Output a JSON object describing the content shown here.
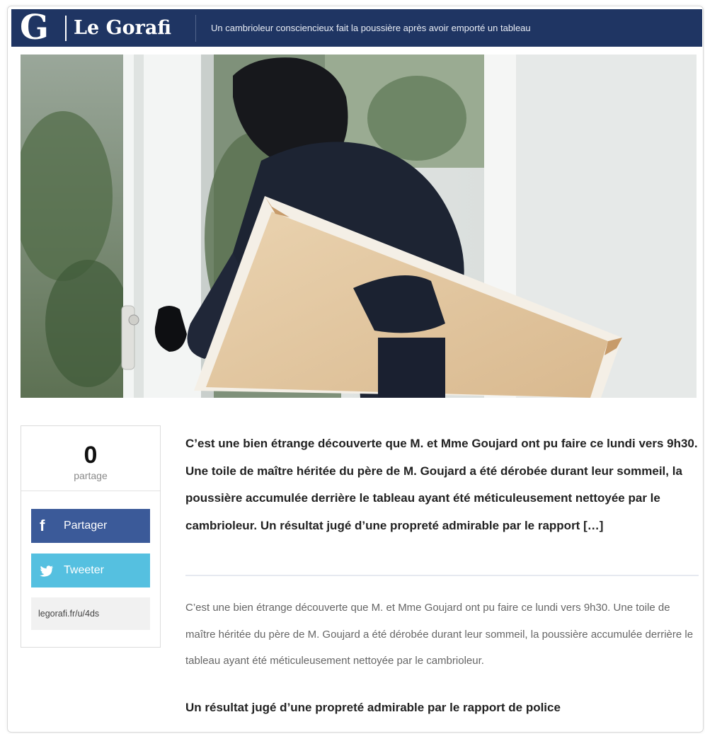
{
  "header": {
    "logo_mark": "G",
    "logo_text": "Le Gorafi",
    "headline": "Un cambrioleur consciencieux fait la poussière après avoir emporté un tableau"
  },
  "share": {
    "count": "0",
    "count_label": "partage",
    "facebook_label": "Partager",
    "twitter_label": "Tweeter",
    "short_url": "legorafi.fr/u/4ds",
    "facebook_icon": "facebook-icon",
    "twitter_icon": "twitter-icon"
  },
  "article": {
    "lede": "C’est une bien étrange découverte que M. et Mme Goujard ont pu faire ce lundi vers 9h30. Une toile de maître héritée du père de M. Goujard a été dérobée durant leur sommeil, la poussière accumulée derrière le tableau ayant été méticuleusement nettoyée par le cambrioleur. Un résultat jugé d’une propreté admirable par le rapport […]",
    "body": "C’est une bien étrange découverte que M. et Mme Goujard ont pu faire ce lundi vers 9h30. Une toile de maître héritée du père de M. Goujard a été dérobée durant leur sommeil, la poussière accumulée derrière le tableau ayant été méticuleusement nettoyée par le cambrioleur.",
    "subheading": "Un résultat jugé d’une propreté admirable par le rapport de police"
  },
  "colors": {
    "header_bg": "#1f3563",
    "facebook": "#3b5a99",
    "twitter": "#55c0e0"
  }
}
